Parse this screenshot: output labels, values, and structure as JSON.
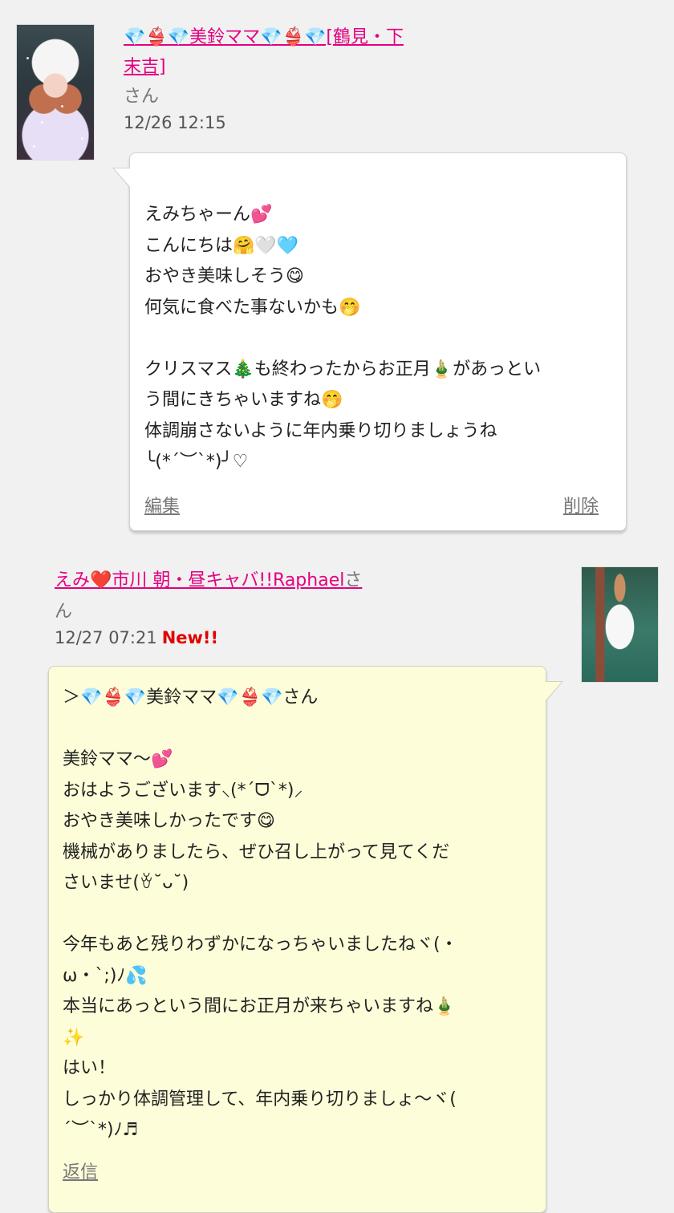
{
  "posts": [
    {
      "author": "💎👙💎美鈴ママ💎👙💎[鶴見・下末吉]",
      "author_line1": "💎👙💎美鈴ママ💎👙💎[鶴見・下",
      "author_line2": "末吉]",
      "suffix": "さん",
      "timestamp": "12/26 12:15",
      "lines": [
        "えみちゃーん💕",
        "こんにちは🤗🤍🩵",
        "おやき美味しそう😋",
        "何気に食べた事ないかも🤭",
        "",
        "クリスマス🎄も終わったからお正月🎍があっとい",
        "う間にきちゃいますね🤭",
        "体調崩さないように年内乗り切りましょうね",
        "╰(*´︶`*)╯♡"
      ],
      "edit_label": "編集",
      "delete_label": "削除"
    },
    {
      "author": "えみ❤️市川 朝・昼キャバ!!Raphael",
      "suffix_inline": "さ",
      "suffix_wrap": "ん",
      "timestamp": "12/27 07:21",
      "new_badge": "New!!",
      "lines": [
        "＞💎👙💎美鈴ママ💎👙💎さん",
        "",
        "美鈴ママ〜💕",
        "おはようございます⸜(*ˊᗜˋ*)⸝",
        "おやき美味しかったです😋",
        "機械がありましたら、ぜひ召し上がって見てくだ",
        "さいませ(ꈊ˘ᴗ˘)",
        "",
        "今年もあと残りわずかになっちゃいましたねヾ(・",
        "ω・`;)ﾉ💦",
        "本当にあっという間にお正月が来ちゃいますね🎍",
        "✨",
        "はい！",
        "しっかり体調管理して、年内乗り切りましょ〜ヾ(",
        "´︶`*)ﾉ♬"
      ],
      "reply_label": "返信"
    }
  ],
  "colors": {
    "link": "#e4007f",
    "new_badge": "#e00000",
    "bubble_mine": "#ffffff",
    "bubble_theirs": "#fdfed9",
    "background": "#f1f1f1"
  }
}
